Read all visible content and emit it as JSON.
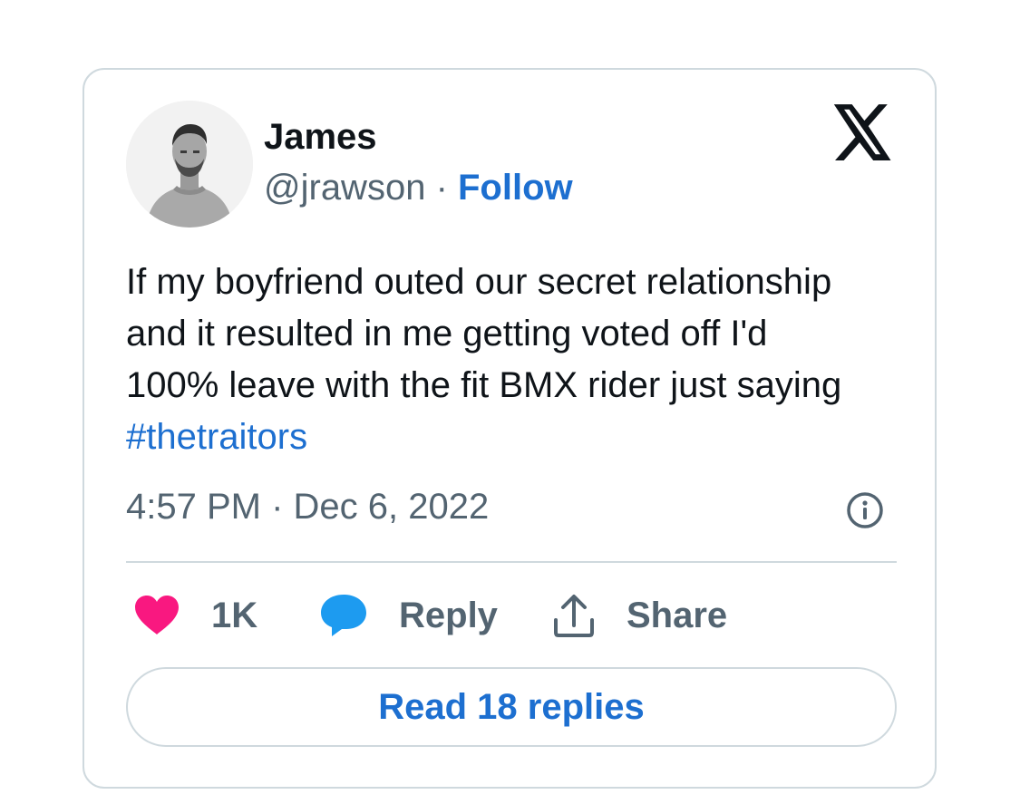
{
  "author": {
    "name": "James",
    "handle": "@jrawson",
    "separator": "·",
    "follow_label": "Follow"
  },
  "tweet": {
    "text": "If my boyfriend outed our secret relationship and it resulted in me getting voted off I'd 100% leave with the fit BMX rider just saying ",
    "hashtag": "#thetraitors",
    "timestamp": "4:57 PM · Dec 6, 2022"
  },
  "actions": {
    "like_count": "1K",
    "reply_label": "Reply",
    "share_label": "Share"
  },
  "read_replies_label": "Read 18 replies",
  "icons": {
    "brand": "x-logo-icon",
    "info": "info-icon",
    "like": "heart-icon",
    "reply": "speech-bubble-icon",
    "share": "share-upload-icon"
  },
  "colors": {
    "link": "#1d6fd0",
    "heart": "#f91880",
    "reply_bubble": "#1d9bf0",
    "secondary_text": "#536471",
    "border": "#cfd9de"
  }
}
